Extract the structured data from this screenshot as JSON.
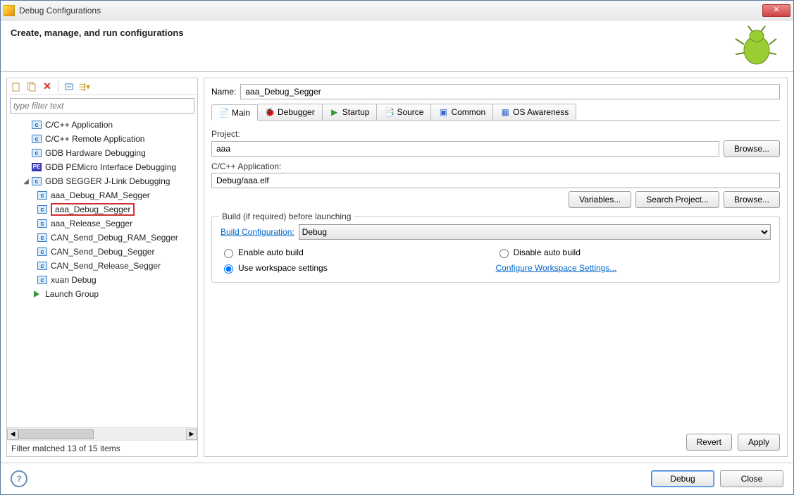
{
  "window": {
    "title": "Debug Configurations"
  },
  "header": {
    "title": "Create, manage, and run configurations"
  },
  "left": {
    "filter_placeholder": "type filter text",
    "categories": [
      {
        "icon": "c",
        "label": "C/C++ Application"
      },
      {
        "icon": "c",
        "label": "C/C++ Remote Application"
      },
      {
        "icon": "c",
        "label": "GDB Hardware Debugging"
      },
      {
        "icon": "pe",
        "label": "GDB PEMicro Interface Debugging"
      }
    ],
    "expanded": {
      "label": "GDB SEGGER J-Link Debugging",
      "children": [
        "aaa_Debug_RAM_Segger",
        "aaa_Debug_Segger",
        "aaa_Release_Segger",
        "CAN_Send_Debug_RAM_Segger",
        "CAN_Send_Debug_Segger",
        "CAN_Send_Release_Segger",
        "xuan Debug"
      ],
      "selected_index": 1
    },
    "launch_group": "Launch Group",
    "filter_status": "Filter matched 13 of 15 items"
  },
  "right": {
    "name_label": "Name:",
    "name_value": "aaa_Debug_Segger",
    "tabs": [
      "Main",
      "Debugger",
      "Startup",
      "Source",
      "Common",
      "OS Awareness"
    ],
    "project_label": "Project:",
    "project_value": "aaa",
    "browse": "Browse...",
    "app_label": "C/C++ Application:",
    "app_value": "Debug/aaa.elf",
    "variables": "Variables...",
    "search_project": "Search Project...",
    "build_group": {
      "legend": "Build (if required) before launching",
      "config_label": "Build Configuration:",
      "config_value": "Debug",
      "enable_auto": "Enable auto build",
      "disable_auto": "Disable auto build",
      "use_workspace": "Use workspace settings",
      "configure_link": "Configure Workspace Settings..."
    },
    "revert": "Revert",
    "apply": "Apply"
  },
  "footer": {
    "debug": "Debug",
    "close": "Close"
  }
}
